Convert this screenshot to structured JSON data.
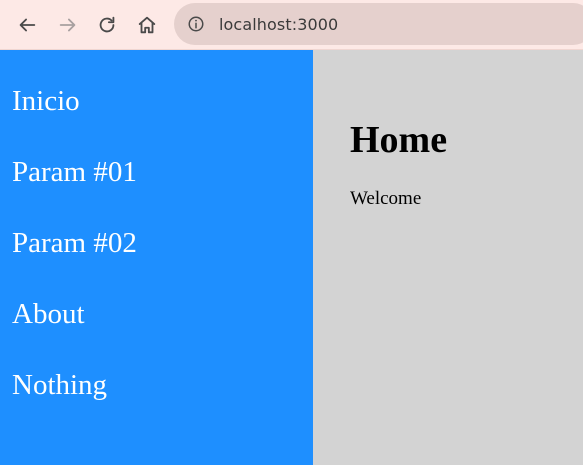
{
  "browser": {
    "url": "localhost:3000",
    "icons": {
      "back": "back-arrow-icon",
      "forward": "forward-arrow-icon",
      "reload": "reload-icon",
      "home": "home-icon",
      "info": "info-icon"
    }
  },
  "sidebar": {
    "background": "#1e8fff",
    "items": [
      {
        "label": "Inicio"
      },
      {
        "label": "Param #01"
      },
      {
        "label": "Param #02"
      },
      {
        "label": "About"
      },
      {
        "label": "Nothing"
      }
    ]
  },
  "main": {
    "background": "#d3d3d3",
    "title": "Home",
    "text": "Welcome"
  }
}
